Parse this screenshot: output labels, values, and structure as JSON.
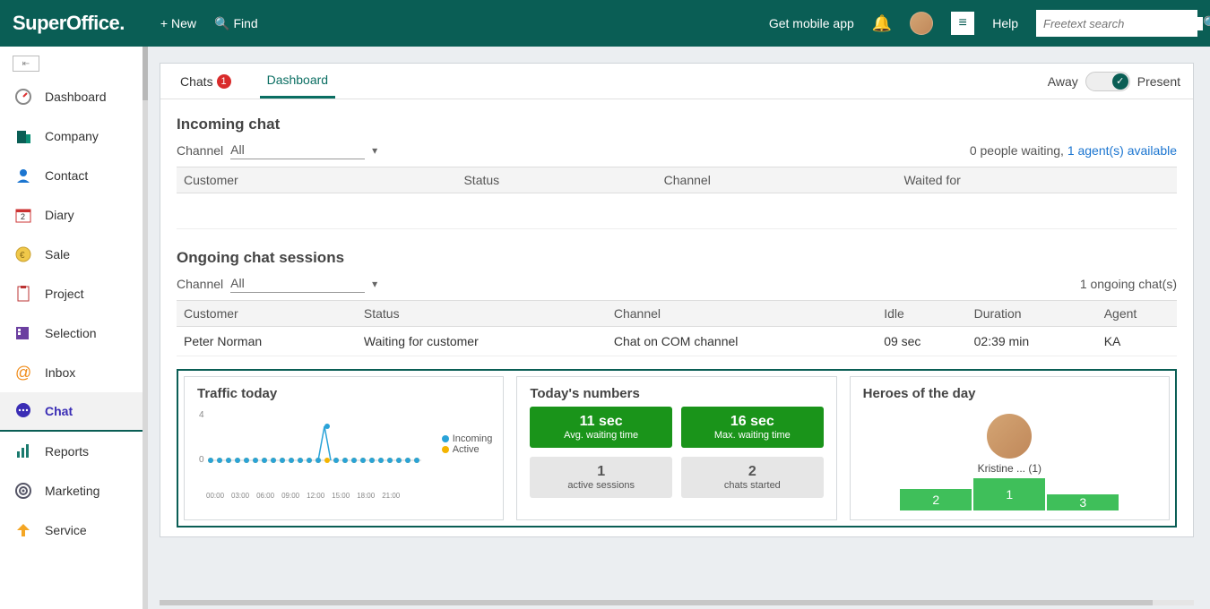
{
  "topbar": {
    "logo": "SuperOffice.",
    "new_label": "New",
    "find_label": "Find",
    "mobile_label": "Get mobile app",
    "help_label": "Help",
    "search_placeholder": "Freetext search"
  },
  "sidebar": {
    "items": [
      {
        "label": "Dashboard"
      },
      {
        "label": "Company"
      },
      {
        "label": "Contact"
      },
      {
        "label": "Diary"
      },
      {
        "label": "Sale"
      },
      {
        "label": "Project"
      },
      {
        "label": "Selection"
      },
      {
        "label": "Inbox"
      },
      {
        "label": "Chat"
      },
      {
        "label": "Reports"
      },
      {
        "label": "Marketing"
      },
      {
        "label": "Service"
      }
    ]
  },
  "tabs": {
    "chats_label": "Chats",
    "chats_badge": "1",
    "dashboard_label": "Dashboard",
    "away_label": "Away",
    "present_label": "Present"
  },
  "incoming": {
    "title": "Incoming chat",
    "channel_label": "Channel",
    "channel_selected": "All",
    "waiting_text": "0  people waiting,",
    "agents_text": "1 agent(s) available",
    "cols": {
      "customer": "Customer",
      "status": "Status",
      "channel": "Channel",
      "waited": "Waited for"
    }
  },
  "ongoing": {
    "title": "Ongoing chat sessions",
    "channel_label": "Channel",
    "channel_selected": "All",
    "count_text": "1  ongoing chat(s)",
    "cols": {
      "customer": "Customer",
      "status": "Status",
      "channel": "Channel",
      "idle": "Idle",
      "duration": "Duration",
      "agent": "Agent"
    },
    "rows": [
      {
        "customer": "Peter Norman",
        "status": "Waiting for customer",
        "channel": "Chat on COM channel",
        "idle": "09 sec",
        "duration": "02:39 min",
        "agent": "KA"
      }
    ]
  },
  "traffic": {
    "title": "Traffic today",
    "y_max": "4",
    "y_min": "0",
    "legend_incoming": "Incoming",
    "legend_active": "Active",
    "x_ticks": [
      "00:00",
      "03:00",
      "06:00",
      "09:00",
      "12:00",
      "15:00",
      "18:00",
      "21:00"
    ]
  },
  "numbers": {
    "title": "Today's numbers",
    "m1_big": "11 sec",
    "m1_small": "Avg. waiting time",
    "m2_big": "16 sec",
    "m2_small": "Max. waiting time",
    "m3_big": "1",
    "m3_small": "active sessions",
    "m4_big": "2",
    "m4_small": "chats started"
  },
  "heroes": {
    "title": "Heroes of the day",
    "name": "Kristine ...   (1)",
    "p1": "1",
    "p2": "2",
    "p3": "3"
  },
  "chart_data": {
    "type": "line",
    "title": "Traffic today",
    "x": [
      "00:00",
      "01:00",
      "02:00",
      "03:00",
      "04:00",
      "05:00",
      "06:00",
      "07:00",
      "08:00",
      "09:00",
      "10:00",
      "11:00",
      "12:00",
      "13:00",
      "14:00",
      "15:00",
      "16:00",
      "17:00",
      "18:00",
      "19:00",
      "20:00",
      "21:00",
      "22:00",
      "23:00"
    ],
    "series": [
      {
        "name": "Incoming",
        "values": [
          0,
          0,
          0,
          0,
          0,
          0,
          0,
          0,
          0,
          0,
          0,
          0,
          0,
          4,
          0,
          0,
          0,
          0,
          0,
          0,
          0,
          0,
          0,
          0
        ]
      },
      {
        "name": "Active",
        "values": [
          0,
          0,
          0,
          0,
          0,
          0,
          0,
          0,
          0,
          0,
          0,
          0,
          0,
          0,
          0,
          0,
          0,
          0,
          0,
          0,
          0,
          0,
          0,
          0
        ]
      }
    ],
    "ylim": [
      0,
      4
    ]
  }
}
